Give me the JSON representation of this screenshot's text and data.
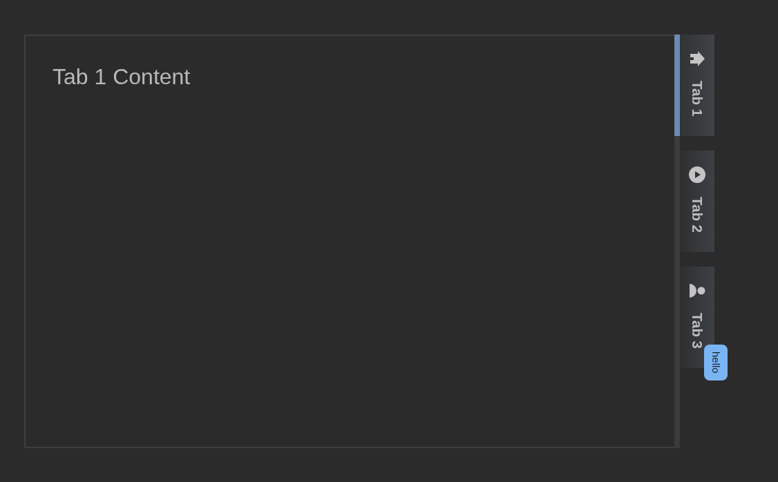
{
  "panel": {
    "text": "Tab 1 Content"
  },
  "tabs": [
    {
      "label": "Tab 1",
      "selected": true
    },
    {
      "label": "Tab 2",
      "selected": false
    },
    {
      "label": "Tab 3",
      "selected": false,
      "badge": "hello"
    }
  ]
}
